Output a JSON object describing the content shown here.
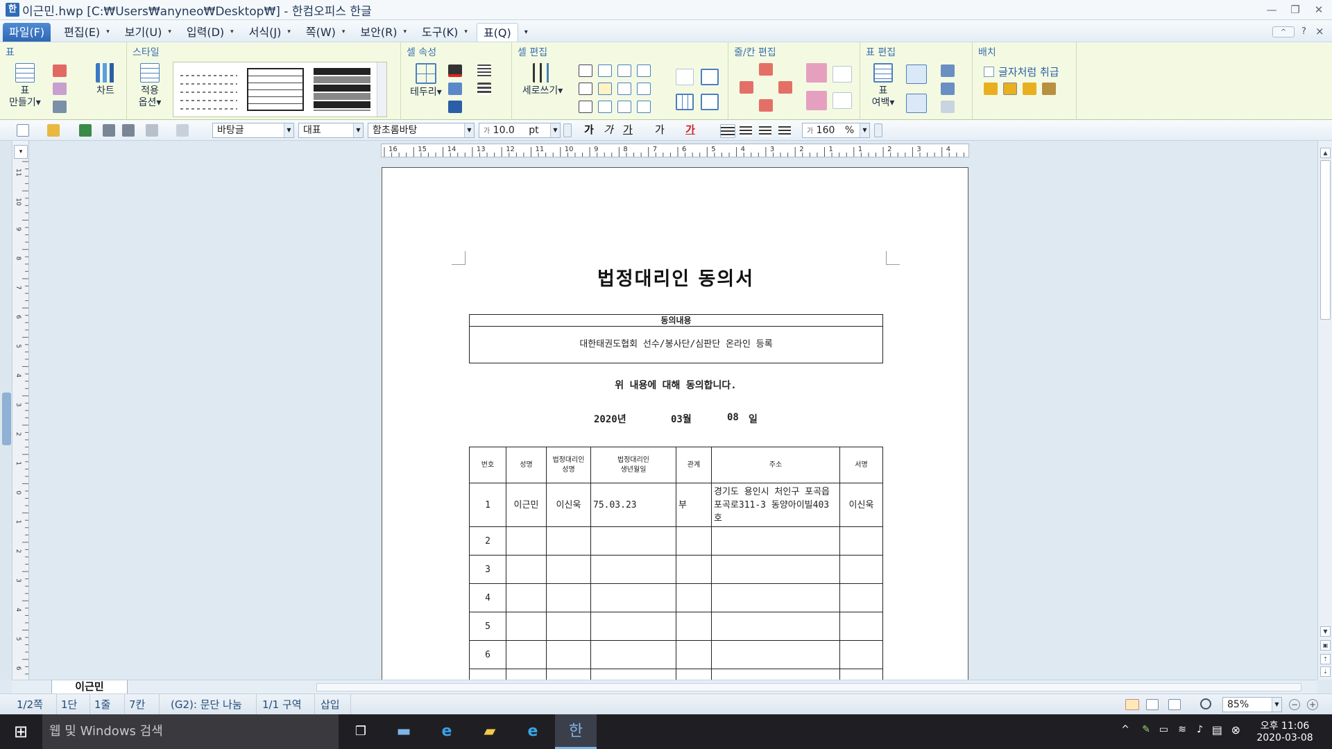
{
  "window": {
    "title": "이근민.hwp [C:₩Users₩anyneo₩Desktop₩] - 한컴오피스 한글",
    "min": "—",
    "restore": "❐",
    "close": "✕",
    "help": "?",
    "collapse": "^",
    "close2": "×"
  },
  "menus": [
    {
      "label": "파일(F)",
      "dd": ""
    },
    {
      "label": "편집(E)",
      "dd": "▾"
    },
    {
      "label": "보기(U)",
      "dd": "▾"
    },
    {
      "label": "입력(D)",
      "dd": "▾"
    },
    {
      "label": "서식(J)",
      "dd": "▾"
    },
    {
      "label": "쪽(W)",
      "dd": "▾"
    },
    {
      "label": "보안(R)",
      "dd": "▾"
    },
    {
      "label": "도구(K)",
      "dd": "▾"
    },
    {
      "label": "표(Q)",
      "dd": ""
    },
    {
      "label": "▾",
      "dd": ""
    }
  ],
  "ribbon": {
    "groups": {
      "table": "표",
      "style": "스타일",
      "cell_props": "셀 속성",
      "cell_edit": "셀 편집",
      "row_col_edit": "줄/칸 편집",
      "table_edit": "표 편집",
      "arrange": "배치"
    },
    "make_table": "표\n만들기▾",
    "chart": "차트",
    "apply_options": "적용\n옵션▾",
    "borders": "테두리▾",
    "vertical_writing": "세로쓰기▾",
    "margin": "표\n여백▾",
    "treat_as_char": "글자처럼 취급",
    "colors": {
      "accent": "#2f67b3",
      "ribbon_bg": "#f4fae2",
      "group_label": "#3a6fb0"
    }
  },
  "toolbar": {
    "style_combo": "바탕글",
    "lang_combo": "대표",
    "font_combo": "함초롬바탕",
    "size_combo": "10.0",
    "size_unit": "pt",
    "size_prefix": "가",
    "line_spacing": "160",
    "line_unit": "%",
    "line_prefix": "가",
    "bold": "가",
    "italic": "가",
    "underline": "가",
    "strike": "가",
    "color": "가"
  },
  "document": {
    "title": "법정대리인 동의서",
    "consent_header": "동의내용",
    "consent_content": "대한태권도협회 선수/봉사단/심판단 온라인 등록",
    "agree_text": "위 내용에 대해 동의합니다.",
    "date": {
      "year": "2020년",
      "month": "03월",
      "day": "08",
      "day_unit": "일"
    },
    "table": {
      "headers": [
        "번호",
        "성명",
        "법정대리인\n성명",
        "법정대리인\n생년월일",
        "관계",
        "주소",
        "서명"
      ],
      "rows": [
        {
          "no": "1",
          "name": "이근민",
          "guardian": "이신욱",
          "birth": "75.03.23",
          "relation": "부",
          "address": "경기도 용인시 처인구 포곡읍 포곡로311-3 동양아이빌403호",
          "sign": "이신욱"
        },
        {
          "no": "2",
          "name": "",
          "guardian": "",
          "birth": "",
          "relation": "",
          "address": "",
          "sign": ""
        },
        {
          "no": "3",
          "name": "",
          "guardian": "",
          "birth": "",
          "relation": "",
          "address": "",
          "sign": ""
        },
        {
          "no": "4",
          "name": "",
          "guardian": "",
          "birth": "",
          "relation": "",
          "address": "",
          "sign": ""
        },
        {
          "no": "5",
          "name": "",
          "guardian": "",
          "birth": "",
          "relation": "",
          "address": "",
          "sign": ""
        },
        {
          "no": "6",
          "name": "",
          "guardian": "",
          "birth": "",
          "relation": "",
          "address": "",
          "sign": ""
        }
      ]
    }
  },
  "ruler": {
    "h_ticks": [
      "16",
      "15",
      "14",
      "13",
      "12",
      "11",
      "10",
      "9",
      "8",
      "7",
      "6",
      "5",
      "4",
      "3",
      "2",
      "1",
      "1",
      "2",
      "3",
      "4"
    ],
    "v_ticks": [
      "11",
      "10",
      "9",
      "8",
      "7",
      "6",
      "5",
      "4",
      "3",
      "2",
      "1",
      "0",
      "1",
      "2",
      "3",
      "4",
      "5",
      "6"
    ]
  },
  "sheet_tab": "이근민",
  "status": {
    "page": "1/2쪽",
    "column": "1단",
    "line": "1줄",
    "col": "7칸",
    "cell": "(G2): 문단 나눔",
    "section": "1/1 구역",
    "mode": "삽입",
    "zoom": "85%"
  },
  "taskbar": {
    "search": "웹 및 Windows 검색",
    "ampm": "오후 11:06",
    "date": "2020-03-08"
  }
}
